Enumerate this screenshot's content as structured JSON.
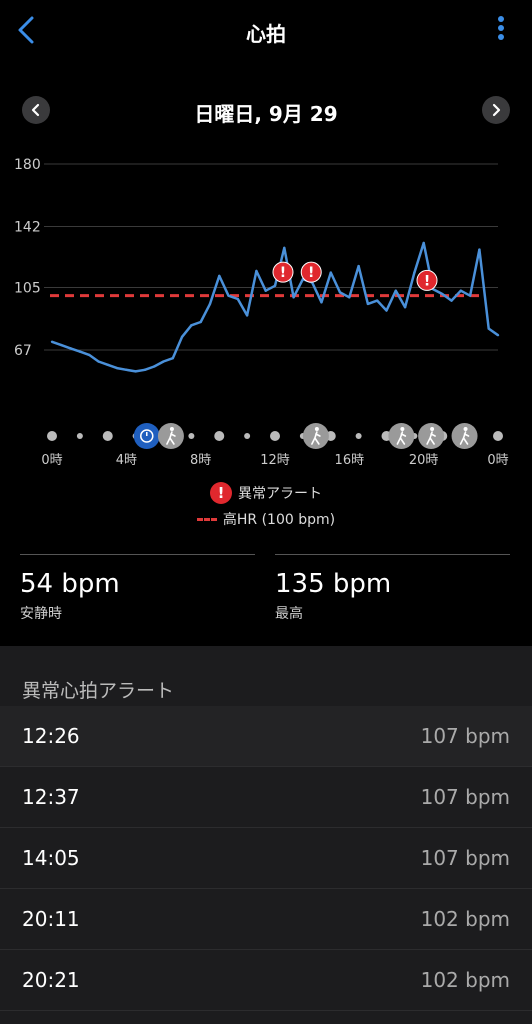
{
  "header": {
    "title": "心拍"
  },
  "date_nav": {
    "date": "日曜日, 9月 29"
  },
  "legend": {
    "alert_label": "異常アラート",
    "high_hr_label": "高HR (100 bpm)"
  },
  "stats": [
    {
      "value": "54 bpm",
      "label": "安静時"
    },
    {
      "value": "135 bpm",
      "label": "最高"
    }
  ],
  "alerts_section": {
    "title": "異常心拍アラート",
    "rows": [
      {
        "time": "12:26",
        "bpm": "107 bpm"
      },
      {
        "time": "12:37",
        "bpm": "107 bpm"
      },
      {
        "time": "14:05",
        "bpm": "107 bpm"
      },
      {
        "time": "20:11",
        "bpm": "102 bpm"
      },
      {
        "time": "20:21",
        "bpm": "102 bpm"
      }
    ]
  },
  "colors": {
    "accent": "#3b8ee8",
    "line": "#4a90d9",
    "threshold": "#e03a3a",
    "alert": "#e0282e"
  },
  "chart_data": {
    "type": "line",
    "y_ticks": [
      "180",
      "142",
      "105",
      "67"
    ],
    "y_tick_values": [
      180,
      142,
      105,
      67
    ],
    "x_ticks": [
      "0時",
      "4時",
      "8時",
      "12時",
      "16時",
      "20時",
      "0時"
    ],
    "x_tick_hours": [
      0,
      4,
      8,
      12,
      16,
      20,
      24
    ],
    "ylim": [
      40,
      180
    ],
    "threshold": 100,
    "x": [
      0,
      0.5,
      1,
      1.5,
      2,
      2.5,
      3,
      3.5,
      4,
      4.5,
      5,
      5.5,
      6,
      6.5,
      7,
      7.5,
      8,
      8.5,
      9,
      9.5,
      10,
      10.5,
      11,
      11.5,
      12,
      12.5,
      13,
      13.5,
      14,
      14.5,
      15,
      15.5,
      16,
      16.5,
      17,
      17.5,
      18,
      18.5,
      19,
      19.5,
      20,
      20.5,
      21,
      21.5,
      22,
      22.5,
      23,
      23.5,
      24
    ],
    "values": [
      72,
      70,
      68,
      66,
      64,
      60,
      58,
      56,
      55,
      54,
      55,
      57,
      60,
      62,
      75,
      82,
      84,
      95,
      112,
      100,
      98,
      88,
      115,
      103,
      106,
      129,
      99,
      110,
      108,
      96,
      114,
      102,
      99,
      118,
      95,
      97,
      91,
      103,
      93,
      114,
      132,
      104,
      101,
      97,
      103,
      100,
      128,
      80,
      76
    ],
    "alert_hours": [
      12.43,
      13.95,
      20.18
    ],
    "alert_values": [
      107,
      107,
      102
    ],
    "activity_hours": [
      6.4,
      14.2,
      18.8,
      20.4,
      22.2
    ]
  }
}
